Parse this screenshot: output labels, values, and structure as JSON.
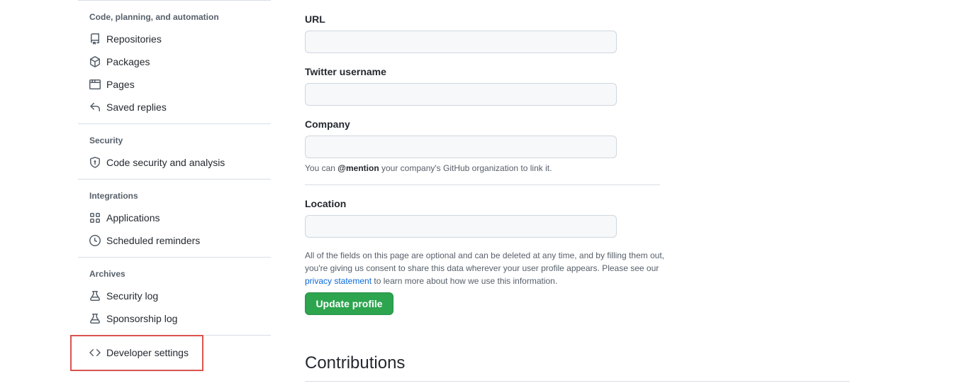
{
  "sidebar": {
    "sections": [
      {
        "heading": "Code, planning, and automation",
        "items": [
          {
            "label": "Repositories",
            "icon": "repo-icon"
          },
          {
            "label": "Packages",
            "icon": "package-icon"
          },
          {
            "label": "Pages",
            "icon": "browser-icon"
          },
          {
            "label": "Saved replies",
            "icon": "reply-icon"
          }
        ]
      },
      {
        "heading": "Security",
        "items": [
          {
            "label": "Code security and analysis",
            "icon": "shield-lock-icon"
          }
        ]
      },
      {
        "heading": "Integrations",
        "items": [
          {
            "label": "Applications",
            "icon": "apps-icon"
          },
          {
            "label": "Scheduled reminders",
            "icon": "clock-icon"
          }
        ]
      },
      {
        "heading": "Archives",
        "items": [
          {
            "label": "Security log",
            "icon": "log-icon"
          },
          {
            "label": "Sponsorship log",
            "icon": "log-icon"
          }
        ]
      }
    ],
    "developer_settings": {
      "label": "Developer settings",
      "icon": "code-icon",
      "highlight_color": "#d9534f"
    }
  },
  "form": {
    "url_label": "URL",
    "url_value": "",
    "twitter_label": "Twitter username",
    "twitter_value": "",
    "company_label": "Company",
    "company_value": "",
    "company_note_prefix": "You can",
    "company_note_mention": "@mention",
    "company_note_suffix": "your company's GitHub organization to link it.",
    "location_label": "Location",
    "location_value": "",
    "disclaimer_text": "All of the fields on this page are optional and can be deleted at any time, and by filling them out, you're giving us consent to share this data wherever your user profile appears. Please see our",
    "privacy_link": "privacy statement",
    "disclaimer_suffix": "to learn more about how we use this information.",
    "update_button": "Update profile"
  },
  "contributions": {
    "title": "Contributions"
  },
  "colors": {
    "accent_green": "#2da44e",
    "link_blue": "#0969da",
    "highlight_red": "#d9534f"
  }
}
